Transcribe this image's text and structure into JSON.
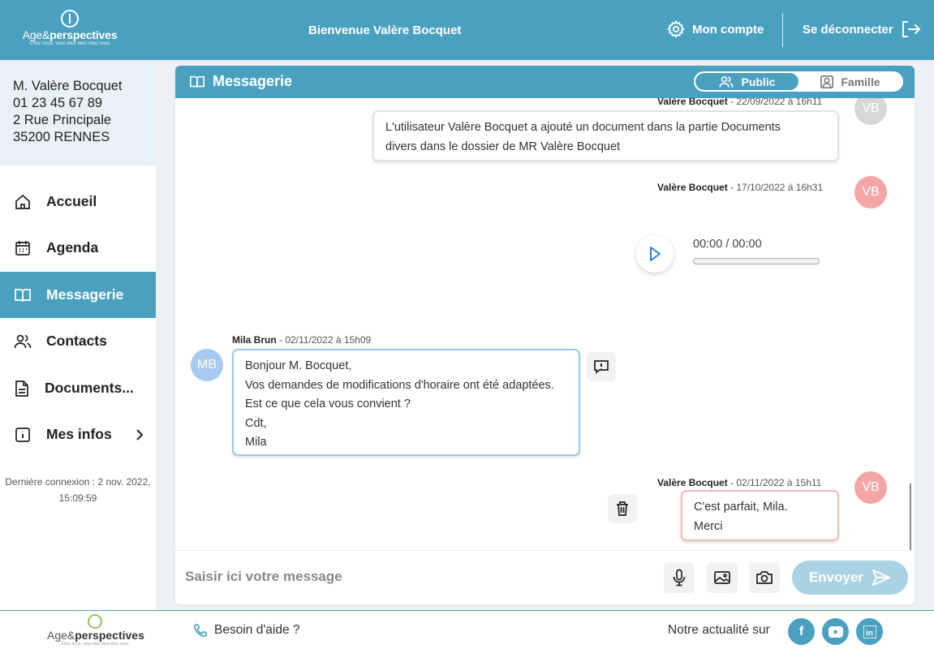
{
  "header": {
    "logo_name_light": "Age&",
    "logo_name_bold": "perspectives",
    "logo_tagline": "Chez nous, vous êtes bien chez vous",
    "welcome": "Bienvenue Valère Bocquet",
    "account_label": "Mon compte",
    "logout_label": "Se déconnecter"
  },
  "user": {
    "name": "M. Valère Bocquet",
    "phone": "01 23 45 67 89",
    "address": "2 Rue Principale",
    "city": "35200 RENNES"
  },
  "sidebar": {
    "items": [
      {
        "label": "Accueil",
        "icon": "home-icon"
      },
      {
        "label": "Agenda",
        "icon": "calendar-icon"
      },
      {
        "label": "Messagerie",
        "icon": "book-icon"
      },
      {
        "label": "Contacts",
        "icon": "users-icon"
      },
      {
        "label": "Documents...",
        "icon": "document-icon"
      },
      {
        "label": "Mes infos",
        "icon": "info-icon"
      }
    ],
    "active": "Messagerie",
    "last_login_label": "Dernière connexion : 2 nov. 2022,",
    "last_login_time": "15:09:59"
  },
  "messagerie": {
    "title": "Messagerie",
    "tab_public": "Public",
    "tab_famille": "Famille",
    "active_tab": "Public",
    "messages": [
      {
        "author": "Valère Bocquet",
        "date": " - 22/09/2022 à 16h11",
        "initials": "VB",
        "lines": [
          "L'utilisateur Valère Bocquet a ajouté un document dans la partie Documents",
          "divers dans le dossier de MR Valère Bocquet"
        ]
      },
      {
        "author": "Valère Bocquet",
        "date": " - 17/10/2022 à 16h31",
        "initials": "VB",
        "audio_time": "00:00 / 00:00",
        "audio_progress": 0
      },
      {
        "author": "Mila Brun",
        "date": " - 02/11/2022 à 15h09",
        "initials": "MB",
        "lines": [
          "Bonjour M. Bocquet,",
          "Vos demandes de modifications d'horaire ont été adaptées.",
          "Est ce que cela vous convient ?",
          "Cdt,",
          "Mila"
        ]
      },
      {
        "author": "Valère Bocquet",
        "date": " - 02/11/2022 à 15h11",
        "initials": "VB",
        "lines": [
          "C'est parfait, Mila.",
          "Merci"
        ]
      }
    ]
  },
  "composer": {
    "placeholder": "Saisir ici votre message",
    "send_label": "Envoyer"
  },
  "footer": {
    "help_label": "Besoin d'aide ?",
    "news_label": "Notre actualité sur",
    "social": [
      "facebook-icon",
      "youtube-icon",
      "linkedin-icon"
    ]
  },
  "colors": {
    "brand": "#4aa0bf",
    "own_bubble_border": "#f2b8b8",
    "other_bubble_border": "#9cc7ea",
    "send_disabled": "#a9d3e4"
  }
}
